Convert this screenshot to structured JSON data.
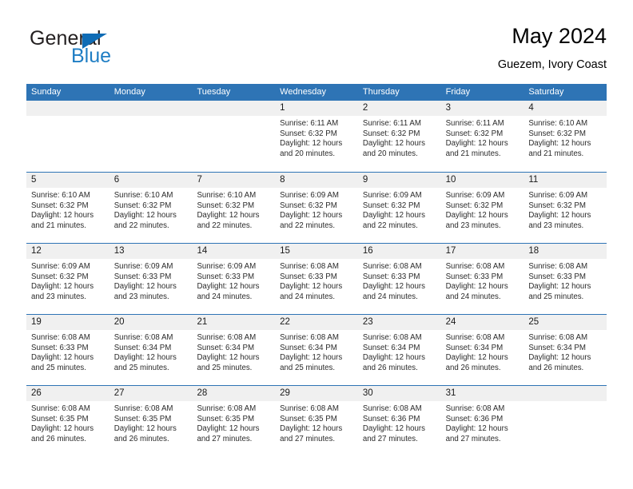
{
  "brand": {
    "name_top": "General",
    "name_bottom": "Blue",
    "triangle_icon": "triangle-icon",
    "color_dark": "#231f20",
    "color_blue": "#1f7ec4"
  },
  "header": {
    "title": "May 2024",
    "subtitle": "Guezem, Ivory Coast"
  },
  "theme": {
    "header_blue": "#2e74b5",
    "daynum_band": "#f0f0f0",
    "text": "#2b2b2b"
  },
  "weekdays": [
    "Sunday",
    "Monday",
    "Tuesday",
    "Wednesday",
    "Thursday",
    "Friday",
    "Saturday"
  ],
  "weeks": [
    [
      {
        "day": "",
        "empty": true,
        "sunrise": "",
        "sunset": "",
        "daylight_1": "",
        "daylight_2": ""
      },
      {
        "day": "",
        "empty": true,
        "sunrise": "",
        "sunset": "",
        "daylight_1": "",
        "daylight_2": ""
      },
      {
        "day": "",
        "empty": true,
        "sunrise": "",
        "sunset": "",
        "daylight_1": "",
        "daylight_2": ""
      },
      {
        "day": "1",
        "empty": false,
        "sunrise": "Sunrise: 6:11 AM",
        "sunset": "Sunset: 6:32 PM",
        "daylight_1": "Daylight: 12 hours",
        "daylight_2": "and 20 minutes."
      },
      {
        "day": "2",
        "empty": false,
        "sunrise": "Sunrise: 6:11 AM",
        "sunset": "Sunset: 6:32 PM",
        "daylight_1": "Daylight: 12 hours",
        "daylight_2": "and 20 minutes."
      },
      {
        "day": "3",
        "empty": false,
        "sunrise": "Sunrise: 6:11 AM",
        "sunset": "Sunset: 6:32 PM",
        "daylight_1": "Daylight: 12 hours",
        "daylight_2": "and 21 minutes."
      },
      {
        "day": "4",
        "empty": false,
        "sunrise": "Sunrise: 6:10 AM",
        "sunset": "Sunset: 6:32 PM",
        "daylight_1": "Daylight: 12 hours",
        "daylight_2": "and 21 minutes."
      }
    ],
    [
      {
        "day": "5",
        "empty": false,
        "sunrise": "Sunrise: 6:10 AM",
        "sunset": "Sunset: 6:32 PM",
        "daylight_1": "Daylight: 12 hours",
        "daylight_2": "and 21 minutes."
      },
      {
        "day": "6",
        "empty": false,
        "sunrise": "Sunrise: 6:10 AM",
        "sunset": "Sunset: 6:32 PM",
        "daylight_1": "Daylight: 12 hours",
        "daylight_2": "and 22 minutes."
      },
      {
        "day": "7",
        "empty": false,
        "sunrise": "Sunrise: 6:10 AM",
        "sunset": "Sunset: 6:32 PM",
        "daylight_1": "Daylight: 12 hours",
        "daylight_2": "and 22 minutes."
      },
      {
        "day": "8",
        "empty": false,
        "sunrise": "Sunrise: 6:09 AM",
        "sunset": "Sunset: 6:32 PM",
        "daylight_1": "Daylight: 12 hours",
        "daylight_2": "and 22 minutes."
      },
      {
        "day": "9",
        "empty": false,
        "sunrise": "Sunrise: 6:09 AM",
        "sunset": "Sunset: 6:32 PM",
        "daylight_1": "Daylight: 12 hours",
        "daylight_2": "and 22 minutes."
      },
      {
        "day": "10",
        "empty": false,
        "sunrise": "Sunrise: 6:09 AM",
        "sunset": "Sunset: 6:32 PM",
        "daylight_1": "Daylight: 12 hours",
        "daylight_2": "and 23 minutes."
      },
      {
        "day": "11",
        "empty": false,
        "sunrise": "Sunrise: 6:09 AM",
        "sunset": "Sunset: 6:32 PM",
        "daylight_1": "Daylight: 12 hours",
        "daylight_2": "and 23 minutes."
      }
    ],
    [
      {
        "day": "12",
        "empty": false,
        "sunrise": "Sunrise: 6:09 AM",
        "sunset": "Sunset: 6:32 PM",
        "daylight_1": "Daylight: 12 hours",
        "daylight_2": "and 23 minutes."
      },
      {
        "day": "13",
        "empty": false,
        "sunrise": "Sunrise: 6:09 AM",
        "sunset": "Sunset: 6:33 PM",
        "daylight_1": "Daylight: 12 hours",
        "daylight_2": "and 23 minutes."
      },
      {
        "day": "14",
        "empty": false,
        "sunrise": "Sunrise: 6:09 AM",
        "sunset": "Sunset: 6:33 PM",
        "daylight_1": "Daylight: 12 hours",
        "daylight_2": "and 24 minutes."
      },
      {
        "day": "15",
        "empty": false,
        "sunrise": "Sunrise: 6:08 AM",
        "sunset": "Sunset: 6:33 PM",
        "daylight_1": "Daylight: 12 hours",
        "daylight_2": "and 24 minutes."
      },
      {
        "day": "16",
        "empty": false,
        "sunrise": "Sunrise: 6:08 AM",
        "sunset": "Sunset: 6:33 PM",
        "daylight_1": "Daylight: 12 hours",
        "daylight_2": "and 24 minutes."
      },
      {
        "day": "17",
        "empty": false,
        "sunrise": "Sunrise: 6:08 AM",
        "sunset": "Sunset: 6:33 PM",
        "daylight_1": "Daylight: 12 hours",
        "daylight_2": "and 24 minutes."
      },
      {
        "day": "18",
        "empty": false,
        "sunrise": "Sunrise: 6:08 AM",
        "sunset": "Sunset: 6:33 PM",
        "daylight_1": "Daylight: 12 hours",
        "daylight_2": "and 25 minutes."
      }
    ],
    [
      {
        "day": "19",
        "empty": false,
        "sunrise": "Sunrise: 6:08 AM",
        "sunset": "Sunset: 6:33 PM",
        "daylight_1": "Daylight: 12 hours",
        "daylight_2": "and 25 minutes."
      },
      {
        "day": "20",
        "empty": false,
        "sunrise": "Sunrise: 6:08 AM",
        "sunset": "Sunset: 6:34 PM",
        "daylight_1": "Daylight: 12 hours",
        "daylight_2": "and 25 minutes."
      },
      {
        "day": "21",
        "empty": false,
        "sunrise": "Sunrise: 6:08 AM",
        "sunset": "Sunset: 6:34 PM",
        "daylight_1": "Daylight: 12 hours",
        "daylight_2": "and 25 minutes."
      },
      {
        "day": "22",
        "empty": false,
        "sunrise": "Sunrise: 6:08 AM",
        "sunset": "Sunset: 6:34 PM",
        "daylight_1": "Daylight: 12 hours",
        "daylight_2": "and 25 minutes."
      },
      {
        "day": "23",
        "empty": false,
        "sunrise": "Sunrise: 6:08 AM",
        "sunset": "Sunset: 6:34 PM",
        "daylight_1": "Daylight: 12 hours",
        "daylight_2": "and 26 minutes."
      },
      {
        "day": "24",
        "empty": false,
        "sunrise": "Sunrise: 6:08 AM",
        "sunset": "Sunset: 6:34 PM",
        "daylight_1": "Daylight: 12 hours",
        "daylight_2": "and 26 minutes."
      },
      {
        "day": "25",
        "empty": false,
        "sunrise": "Sunrise: 6:08 AM",
        "sunset": "Sunset: 6:34 PM",
        "daylight_1": "Daylight: 12 hours",
        "daylight_2": "and 26 minutes."
      }
    ],
    [
      {
        "day": "26",
        "empty": false,
        "sunrise": "Sunrise: 6:08 AM",
        "sunset": "Sunset: 6:35 PM",
        "daylight_1": "Daylight: 12 hours",
        "daylight_2": "and 26 minutes."
      },
      {
        "day": "27",
        "empty": false,
        "sunrise": "Sunrise: 6:08 AM",
        "sunset": "Sunset: 6:35 PM",
        "daylight_1": "Daylight: 12 hours",
        "daylight_2": "and 26 minutes."
      },
      {
        "day": "28",
        "empty": false,
        "sunrise": "Sunrise: 6:08 AM",
        "sunset": "Sunset: 6:35 PM",
        "daylight_1": "Daylight: 12 hours",
        "daylight_2": "and 27 minutes."
      },
      {
        "day": "29",
        "empty": false,
        "sunrise": "Sunrise: 6:08 AM",
        "sunset": "Sunset: 6:35 PM",
        "daylight_1": "Daylight: 12 hours",
        "daylight_2": "and 27 minutes."
      },
      {
        "day": "30",
        "empty": false,
        "sunrise": "Sunrise: 6:08 AM",
        "sunset": "Sunset: 6:36 PM",
        "daylight_1": "Daylight: 12 hours",
        "daylight_2": "and 27 minutes."
      },
      {
        "day": "31",
        "empty": false,
        "sunrise": "Sunrise: 6:08 AM",
        "sunset": "Sunset: 6:36 PM",
        "daylight_1": "Daylight: 12 hours",
        "daylight_2": "and 27 minutes."
      },
      {
        "day": "",
        "empty": true,
        "sunrise": "",
        "sunset": "",
        "daylight_1": "",
        "daylight_2": ""
      }
    ]
  ]
}
